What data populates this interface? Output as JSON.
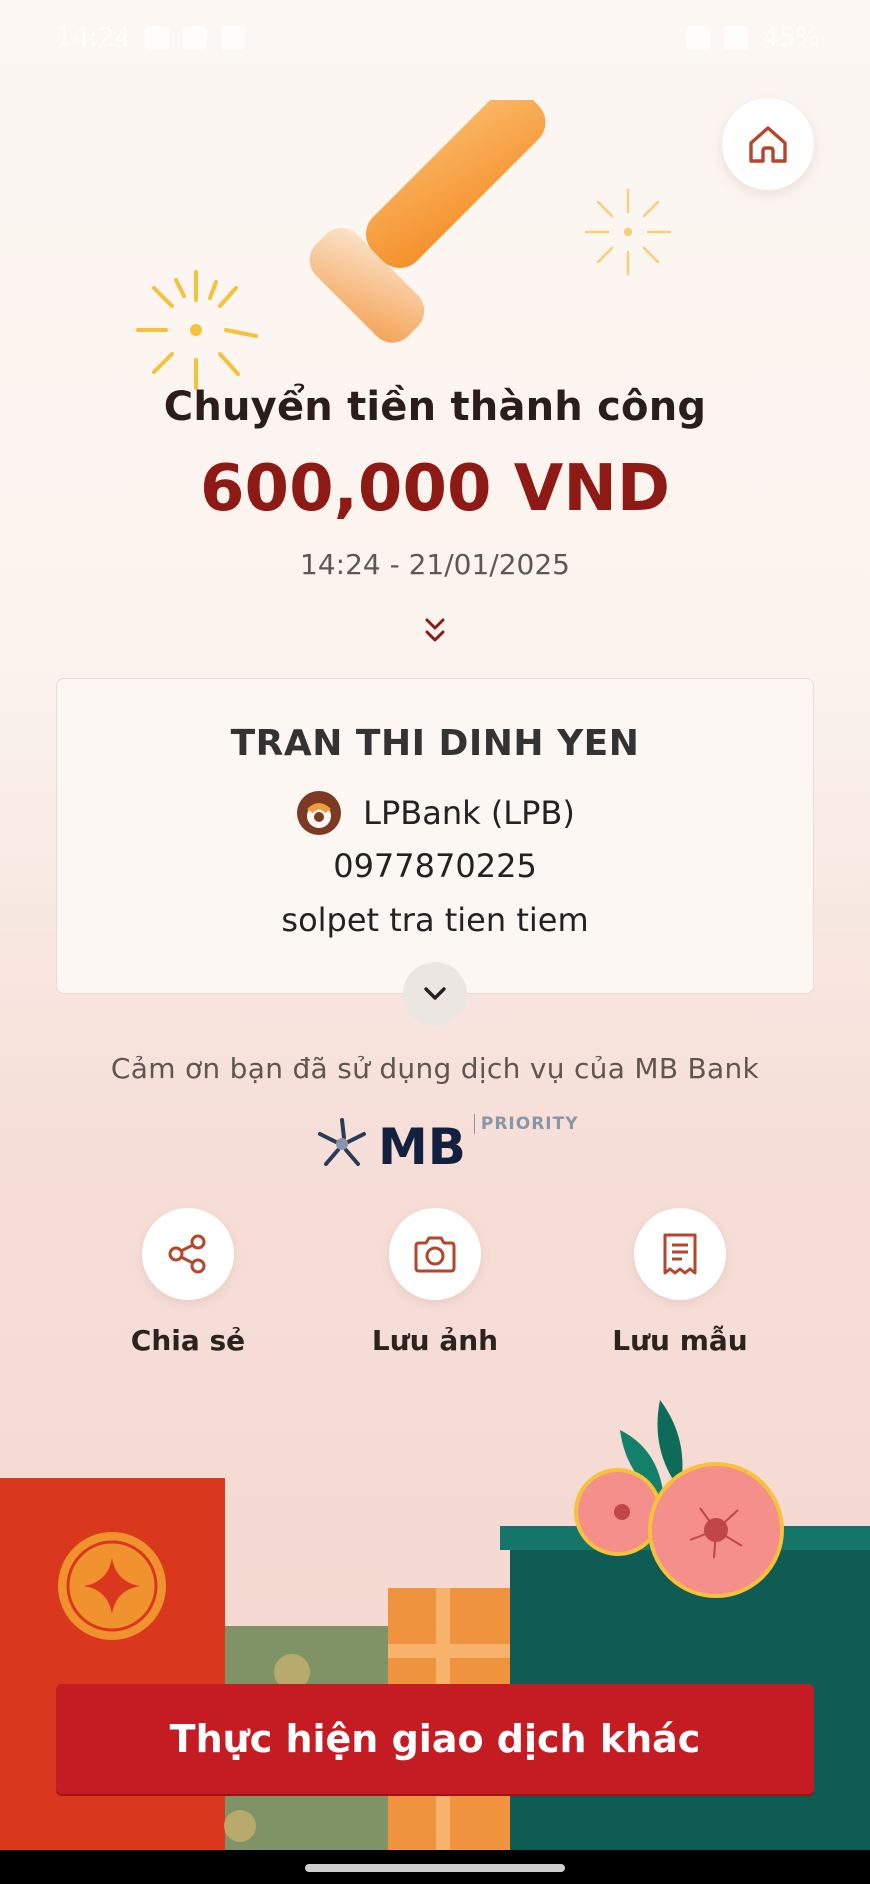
{
  "status_bar": {
    "time": "14:24",
    "battery": "45%"
  },
  "header": {
    "home_icon": "home-icon"
  },
  "result": {
    "title": "Chuyển tiền thành công",
    "amount": "600,000 VND",
    "datetime": "14:24 - 21/01/2025"
  },
  "recipient": {
    "name": "TRAN THI DINH YEN",
    "bank": "LPBank (LPB)",
    "account": "0977870225",
    "memo": "solpet tra tien tiem"
  },
  "footer": {
    "thanks": "Cảm ơn bạn đã sử dụng dịch vụ của MB Bank",
    "brand": "MB",
    "brand_tier": "PRIORITY"
  },
  "actions": [
    {
      "label": "Chia sẻ",
      "icon": "share-icon"
    },
    {
      "label": "Lưu ảnh",
      "icon": "camera-icon"
    },
    {
      "label": "Lưu mẫu",
      "icon": "receipt-icon"
    }
  ],
  "cta": {
    "label": "Thực hiện giao dịch khác"
  },
  "colors": {
    "amount": "#8e1a16",
    "cta": "#c41c22",
    "accent_orange": "#f39a3b"
  }
}
